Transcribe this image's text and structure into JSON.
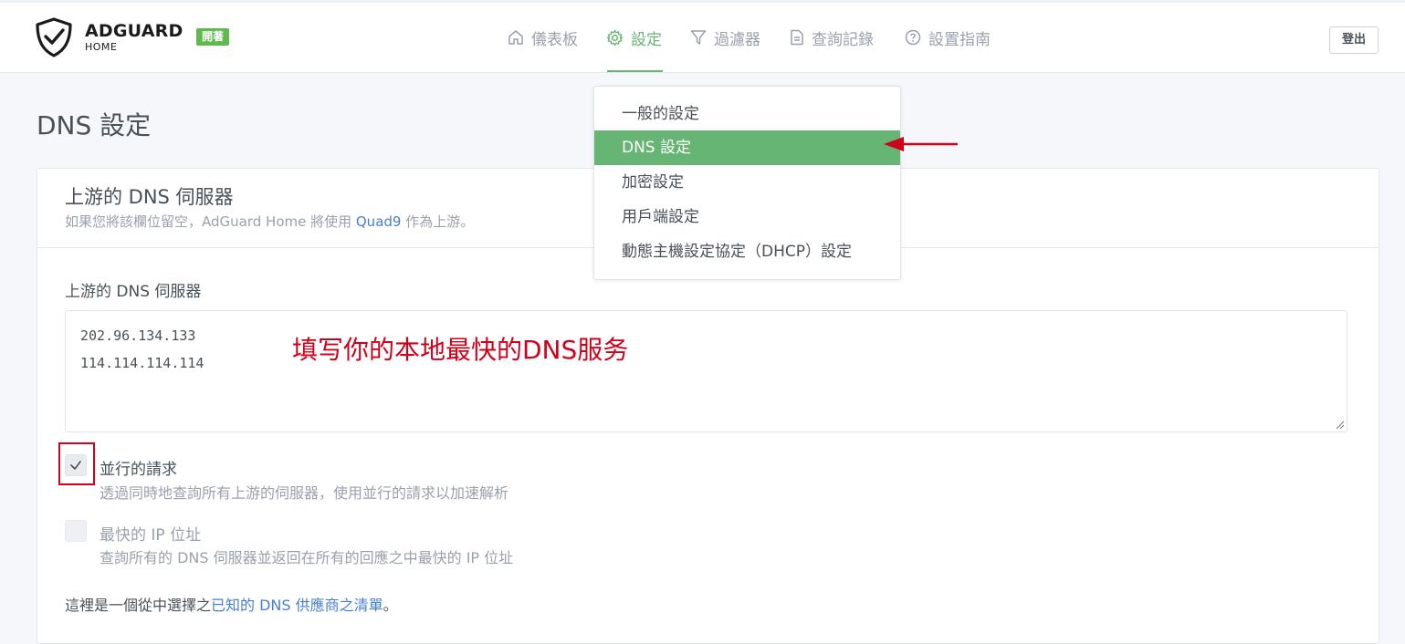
{
  "header": {
    "brand": "ADGUARD",
    "brand_sub": "HOME",
    "badge": "開著",
    "nav": [
      {
        "label": "儀表板",
        "icon": "home-icon"
      },
      {
        "label": "設定",
        "icon": "gear-icon",
        "active": true
      },
      {
        "label": "過濾器",
        "icon": "filter-icon"
      },
      {
        "label": "查詢記錄",
        "icon": "document-icon"
      },
      {
        "label": "設置指南",
        "icon": "help-circle-icon"
      }
    ],
    "logout": "登出"
  },
  "page": {
    "title": "DNS 設定"
  },
  "card": {
    "title": "上游的 DNS 伺服器",
    "subtitle_before": "如果您將該欄位留空，AdGuard Home 將使用 ",
    "subtitle_link": "Quad9",
    "subtitle_after": " 作為上游。",
    "field_label": "上游的 DNS 伺服器",
    "upstreams": [
      "202.96.134.133",
      "114.114.114.114"
    ],
    "annotation": "填写你的本地最快的DNS服务",
    "options": [
      {
        "title": "並行的請求",
        "desc": "透過同時地查詢所有上游的伺服器，使用並行的請求以加速解析",
        "checked": true,
        "enabled": true
      },
      {
        "title": "最快的 IP 位址",
        "desc": "查詢所有的 DNS 伺服器並返回在所有的回應之中最快的 IP 位址",
        "checked": false,
        "enabled": false
      }
    ],
    "footer_before": "這裡是一個從中選擇之",
    "footer_link": "已知的 DNS 供應商之清單",
    "footer_after": "。"
  },
  "dropdown": {
    "items": [
      {
        "label": "一般的設定"
      },
      {
        "label": "DNS 設定",
        "active": true
      },
      {
        "label": "加密設定"
      },
      {
        "label": "用戶端設定"
      },
      {
        "label": "動態主機設定協定（DHCP）設定"
      }
    ]
  },
  "colors": {
    "accent": "#66b574",
    "link": "#467fcf",
    "annotation": "#d0021b",
    "badge": "#5eba4d"
  }
}
